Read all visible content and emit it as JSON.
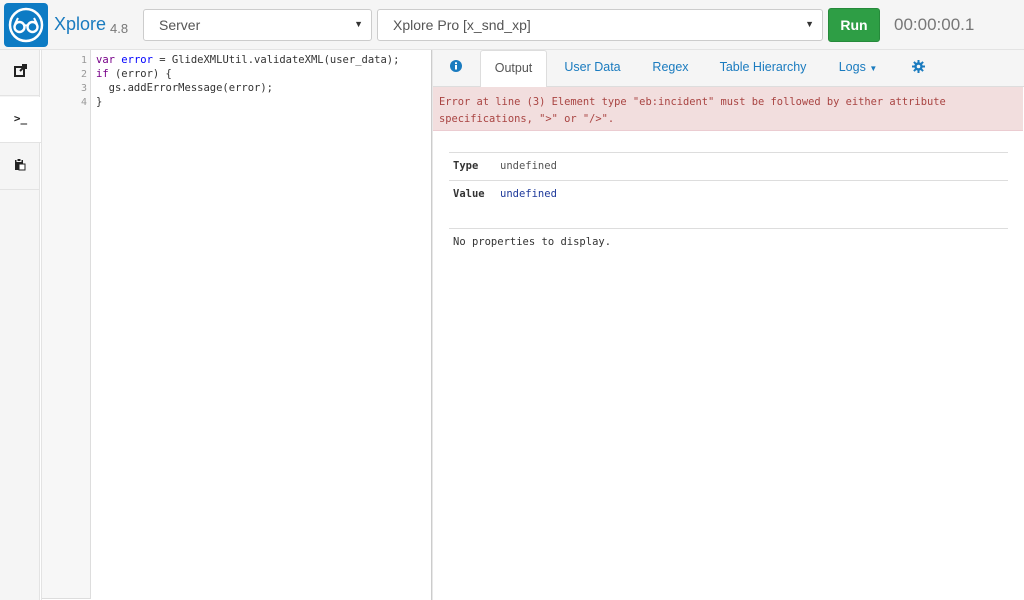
{
  "header": {
    "app_name": "Xplore",
    "version": "4.8",
    "server_select": "Server",
    "scope_select": "Xplore Pro [x_snd_xp]",
    "run_label": "Run",
    "timer": "00:00:00.1"
  },
  "colors": {
    "brand": "#0d7bc4",
    "run_button": "#2e9e45",
    "error_bg": "#f2dede",
    "error_text": "#a94442",
    "link": "#1a7bbf"
  },
  "rail": {
    "items": [
      {
        "icon": "external-link-icon"
      },
      {
        "icon": "terminal-prompt-icon",
        "label": ">_"
      },
      {
        "icon": "clipboard-icon"
      }
    ]
  },
  "editor": {
    "line_numbers": [
      "1",
      "2",
      "3",
      "4"
    ],
    "lines": [
      {
        "kw": "var",
        "var": "error",
        "rest": " = GlideXMLUtil.validateXML(user_data);"
      },
      {
        "kw": "if",
        "rest": " (error) {"
      },
      {
        "rest": "  gs.addErrorMessage(error);"
      },
      {
        "rest": "}"
      }
    ]
  },
  "tabs": {
    "info_icon": "info-circle-icon",
    "output": "Output",
    "user_data": "User Data",
    "regex": "Regex",
    "table_hierarchy": "Table Hierarchy",
    "logs": "Logs",
    "settings_icon": "gear-icon"
  },
  "output": {
    "error_line1": "Error at line (3) Element type \"eb:incident\" must be followed by either attribute",
    "error_line2": "specifications, \">\" or \"/>\".",
    "type_label": "Type",
    "type_value": "undefined",
    "value_label": "Value",
    "value_value": "undefined",
    "no_props": "No properties to display."
  }
}
